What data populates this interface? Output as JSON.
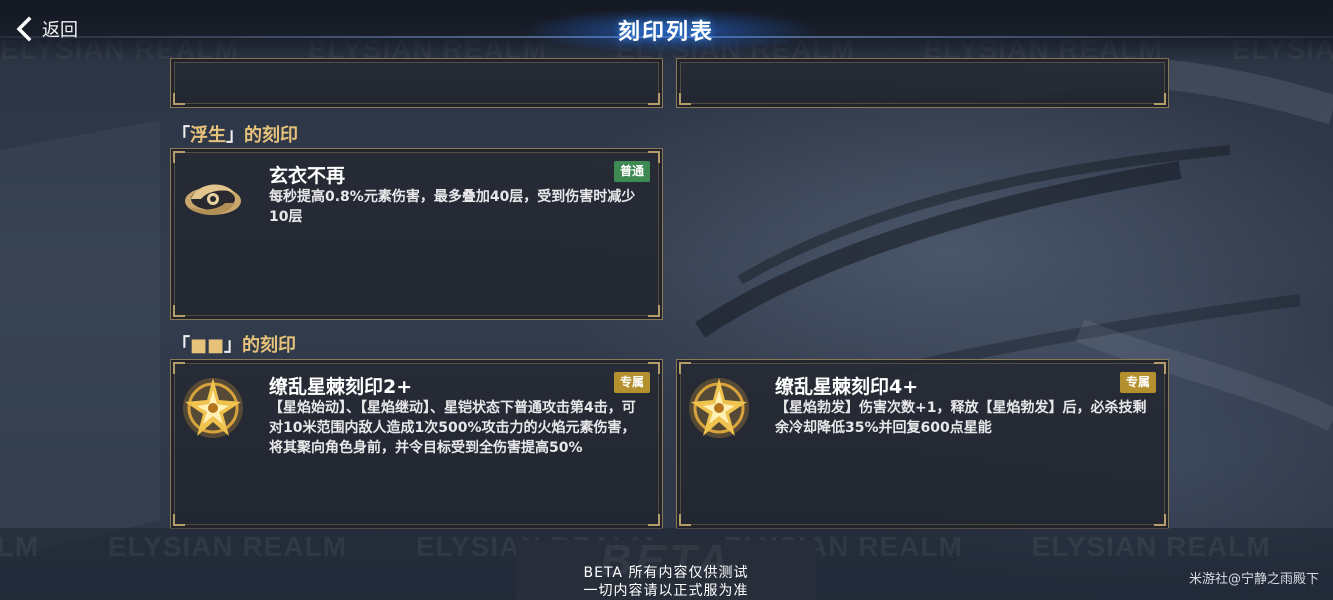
{
  "header": {
    "back_label": "返回",
    "title": "刻印列表"
  },
  "watermark": {
    "text": "ELYSIAN REALM"
  },
  "sections": [
    {
      "header_open": "「",
      "header_name": "浮生",
      "header_close": "」",
      "header_suffix": "的刻印",
      "cards": [
        {
          "name": "玄衣不再",
          "badge": "普通",
          "badge_color": "#3f8a52",
          "description": "每秒提高0.8%元素伤害，最多叠加40层，受到伤害时减少10层",
          "icon": "swirl-emblem-icon"
        }
      ]
    },
    {
      "header_open": "「",
      "header_name": "■■",
      "header_close": "」",
      "header_suffix": "的刻印",
      "cards": [
        {
          "name": "缭乱星棘刻印2+",
          "badge": "专属",
          "badge_color": "#b4902f",
          "description": "【星焰始动】、【星焰继动】、星铠状态下普通攻击第4击，可对10米范围内敌人造成1次500%攻击力的火焰元素伤害，将其聚向角色身前，并令目标受到全伤害提高50%",
          "icon": "star-thorn-emblem-icon"
        },
        {
          "name": "缭乱星棘刻印4+",
          "badge": "专属",
          "badge_color": "#b4902f",
          "description": "【星焰勃发】伤害次数+1，释放【星焰勃发】后，必杀技剩余冷却降低35%并回复600点星能",
          "icon": "star-thorn-emblem-icon"
        }
      ]
    }
  ],
  "footer": {
    "beta_watermark": "BETA",
    "beta_line1": "BETA 所有内容仅供测试",
    "beta_line2": "一切内容请以正式服为准",
    "credit": "米游社@宁静之雨殿下"
  },
  "colors": {
    "accent_gold": "#e7c27a",
    "card_border": "#8b7a58",
    "title_glow": "#2878ff"
  }
}
